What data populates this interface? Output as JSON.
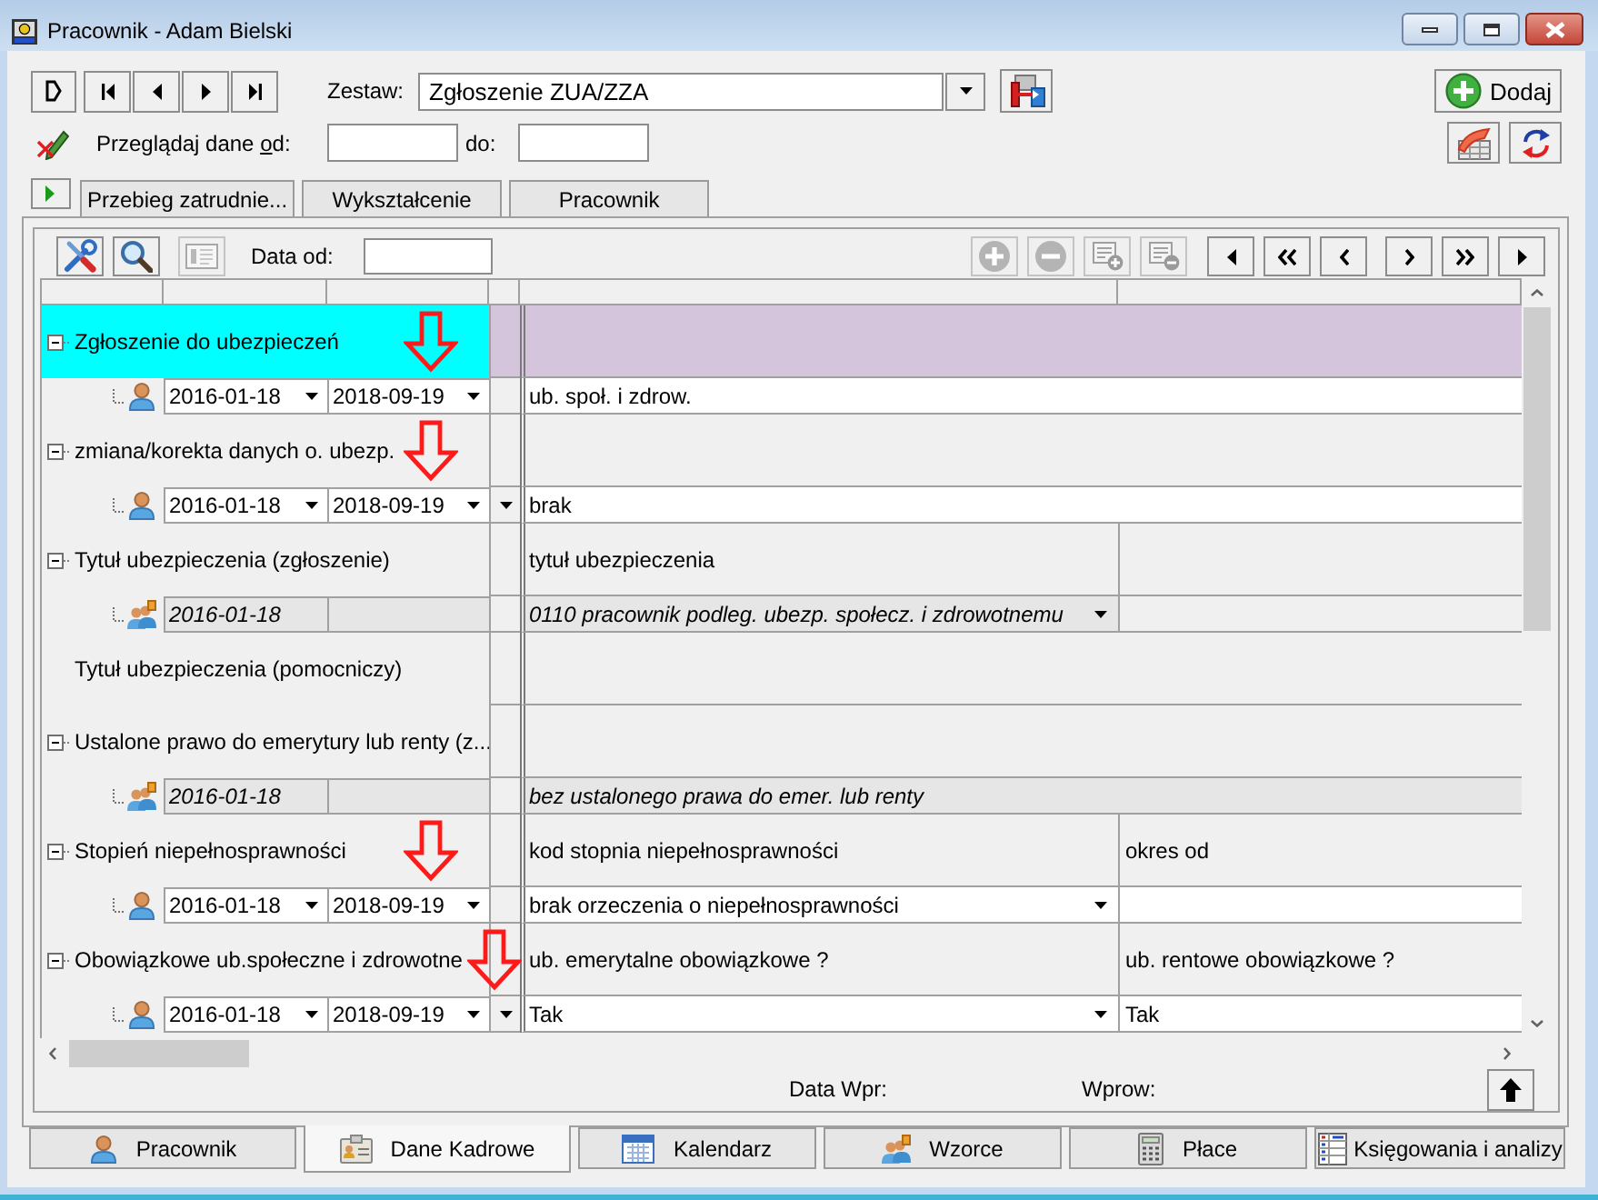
{
  "window": {
    "title": "Pracownik - Adam Bielski"
  },
  "record_nav": [
    {
      "kind": "new"
    },
    {
      "kind": "first"
    },
    {
      "kind": "previous"
    },
    {
      "kind": "next"
    },
    {
      "kind": "last"
    }
  ],
  "set_selector": {
    "label": "Zestaw:",
    "value": "Zgłoszenie ZUA/ZZA"
  },
  "add_button": {
    "label": "Dodaj"
  },
  "date_filter": {
    "label_before": "Przeglądaj dane ",
    "access_key": "o",
    "label_after": "d:",
    "to_label": "do:"
  },
  "tabs": [
    {
      "label": "Przebieg zatrudnie...",
      "selected": false
    },
    {
      "label": "Wykształcenie",
      "selected": false
    },
    {
      "label": "Pracownik",
      "selected": false
    }
  ],
  "panel_toolbar": {
    "left_buttons": [
      {
        "kind": "tools",
        "disabled": false
      },
      {
        "kind": "search",
        "disabled": false
      },
      {
        "kind": "card",
        "disabled": true
      }
    ],
    "date_label": "Data od:",
    "right_buttons": [
      {
        "kind": "add",
        "disabled": true
      },
      {
        "kind": "remove",
        "disabled": true
      },
      {
        "kind": "addrow",
        "disabled": true
      },
      {
        "kind": "removerow",
        "disabled": true
      },
      {
        "kind": "start",
        "disabled": false
      },
      {
        "kind": "rewind",
        "disabled": false
      },
      {
        "kind": "prev",
        "disabled": false
      },
      {
        "kind": "next",
        "disabled": false
      },
      {
        "kind": "forward",
        "disabled": false
      },
      {
        "kind": "end",
        "disabled": false
      }
    ]
  },
  "grid": {
    "groups": [
      {
        "label": "Zgłoszenie do ubezpieczeń",
        "expanded": true,
        "selected": true,
        "marked": true,
        "entry": {
          "kind": "own",
          "date_from": "2016-01-18",
          "date_to": "2018-09-19",
          "dropdown": false,
          "cells": [
            {
              "kind": "wide",
              "text": "ub. społ. i zdrow.",
              "dropdown": false
            }
          ]
        }
      },
      {
        "label": "zmiana/korekta danych o. ubezp.",
        "expanded": true,
        "selected": false,
        "marked": true,
        "entry": {
          "kind": "own",
          "date_from": "2016-01-18",
          "date_to": "2018-09-19",
          "dropdown": true,
          "cells": [
            {
              "kind": "wide",
              "text": "brak",
              "dropdown": false
            }
          ]
        }
      },
      {
        "label": "Tytuł ubezpieczenia (zgłoszenie)",
        "expanded": true,
        "selected": false,
        "marked": false,
        "cells": [
          {
            "kind": "half",
            "text": "tytuł ubezpieczenia"
          },
          {
            "kind": "half"
          }
        ],
        "entry": {
          "kind": "template",
          "date_from": "2016-01-18",
          "dropdown": false,
          "cells": [
            {
              "kind": "half",
              "text": "0110 pracownik podleg. ubezp. społecz. i zdrowotnemu",
              "dropdown": true
            },
            {
              "kind": "half",
              "dropdown": false
            }
          ]
        }
      },
      {
        "label": "Tytuł ubezpieczenia (pomocniczy)",
        "selected": false,
        "marked": false
      },
      {
        "label": "Ustalone prawo do emerytury lub renty (z...",
        "expanded": true,
        "selected": false,
        "marked": false,
        "entry": {
          "kind": "template",
          "date_from": "2016-01-18",
          "dropdown": false,
          "cells": [
            {
              "kind": "wide",
              "text": "bez ustalonego prawa do emer. lub renty",
              "dropdown": false
            }
          ]
        }
      },
      {
        "label": "Stopień niepełnosprawności",
        "expanded": true,
        "selected": false,
        "marked": true,
        "cells": [
          {
            "kind": "half",
            "text": "kod stopnia niepełnosprawności"
          },
          {
            "kind": "half",
            "text": "okres od"
          }
        ],
        "entry": {
          "kind": "own",
          "date_from": "2016-01-18",
          "date_to": "2018-09-19",
          "dropdown": false,
          "cells": [
            {
              "kind": "half",
              "text": "brak orzeczenia o niepełnosprawności",
              "dropdown": true
            },
            {
              "kind": "half",
              "dropdown": false
            }
          ]
        }
      },
      {
        "label": "Obowiązkowe ub.społeczne i zdrowotne",
        "expanded": true,
        "selected": false,
        "marked": true,
        "cells": [
          {
            "kind": "half",
            "text": "ub. emerytalne obowiązkowe ?"
          },
          {
            "kind": "half",
            "text": "ub. rentowe obowiązkowe ?"
          }
        ],
        "entry": {
          "kind": "own",
          "date_from": "2016-01-18",
          "date_to": "2018-09-19",
          "dropdown": true,
          "cells": [
            {
              "kind": "half",
              "text": "Tak",
              "dropdown": true
            },
            {
              "kind": "half",
              "text": "Tak",
              "dropdown": false
            }
          ]
        }
      }
    ]
  },
  "footer": {
    "entry_date_label": "Data Wpr:",
    "entered_by_label": "Wprow:"
  },
  "bottom_tabs": [
    {
      "label": "Pracownik",
      "kind": "person",
      "selected": false
    },
    {
      "label": "Dane Kadrowe",
      "kind": "card",
      "selected": true
    },
    {
      "label": "Kalendarz",
      "kind": "calendar",
      "selected": false
    },
    {
      "label": "Wzorce",
      "kind": "people",
      "selected": false
    },
    {
      "label": "Płace",
      "kind": "calculator",
      "selected": false
    },
    {
      "label": "Księgowania i analizy",
      "kind": "ledger",
      "selected": false
    }
  ]
}
